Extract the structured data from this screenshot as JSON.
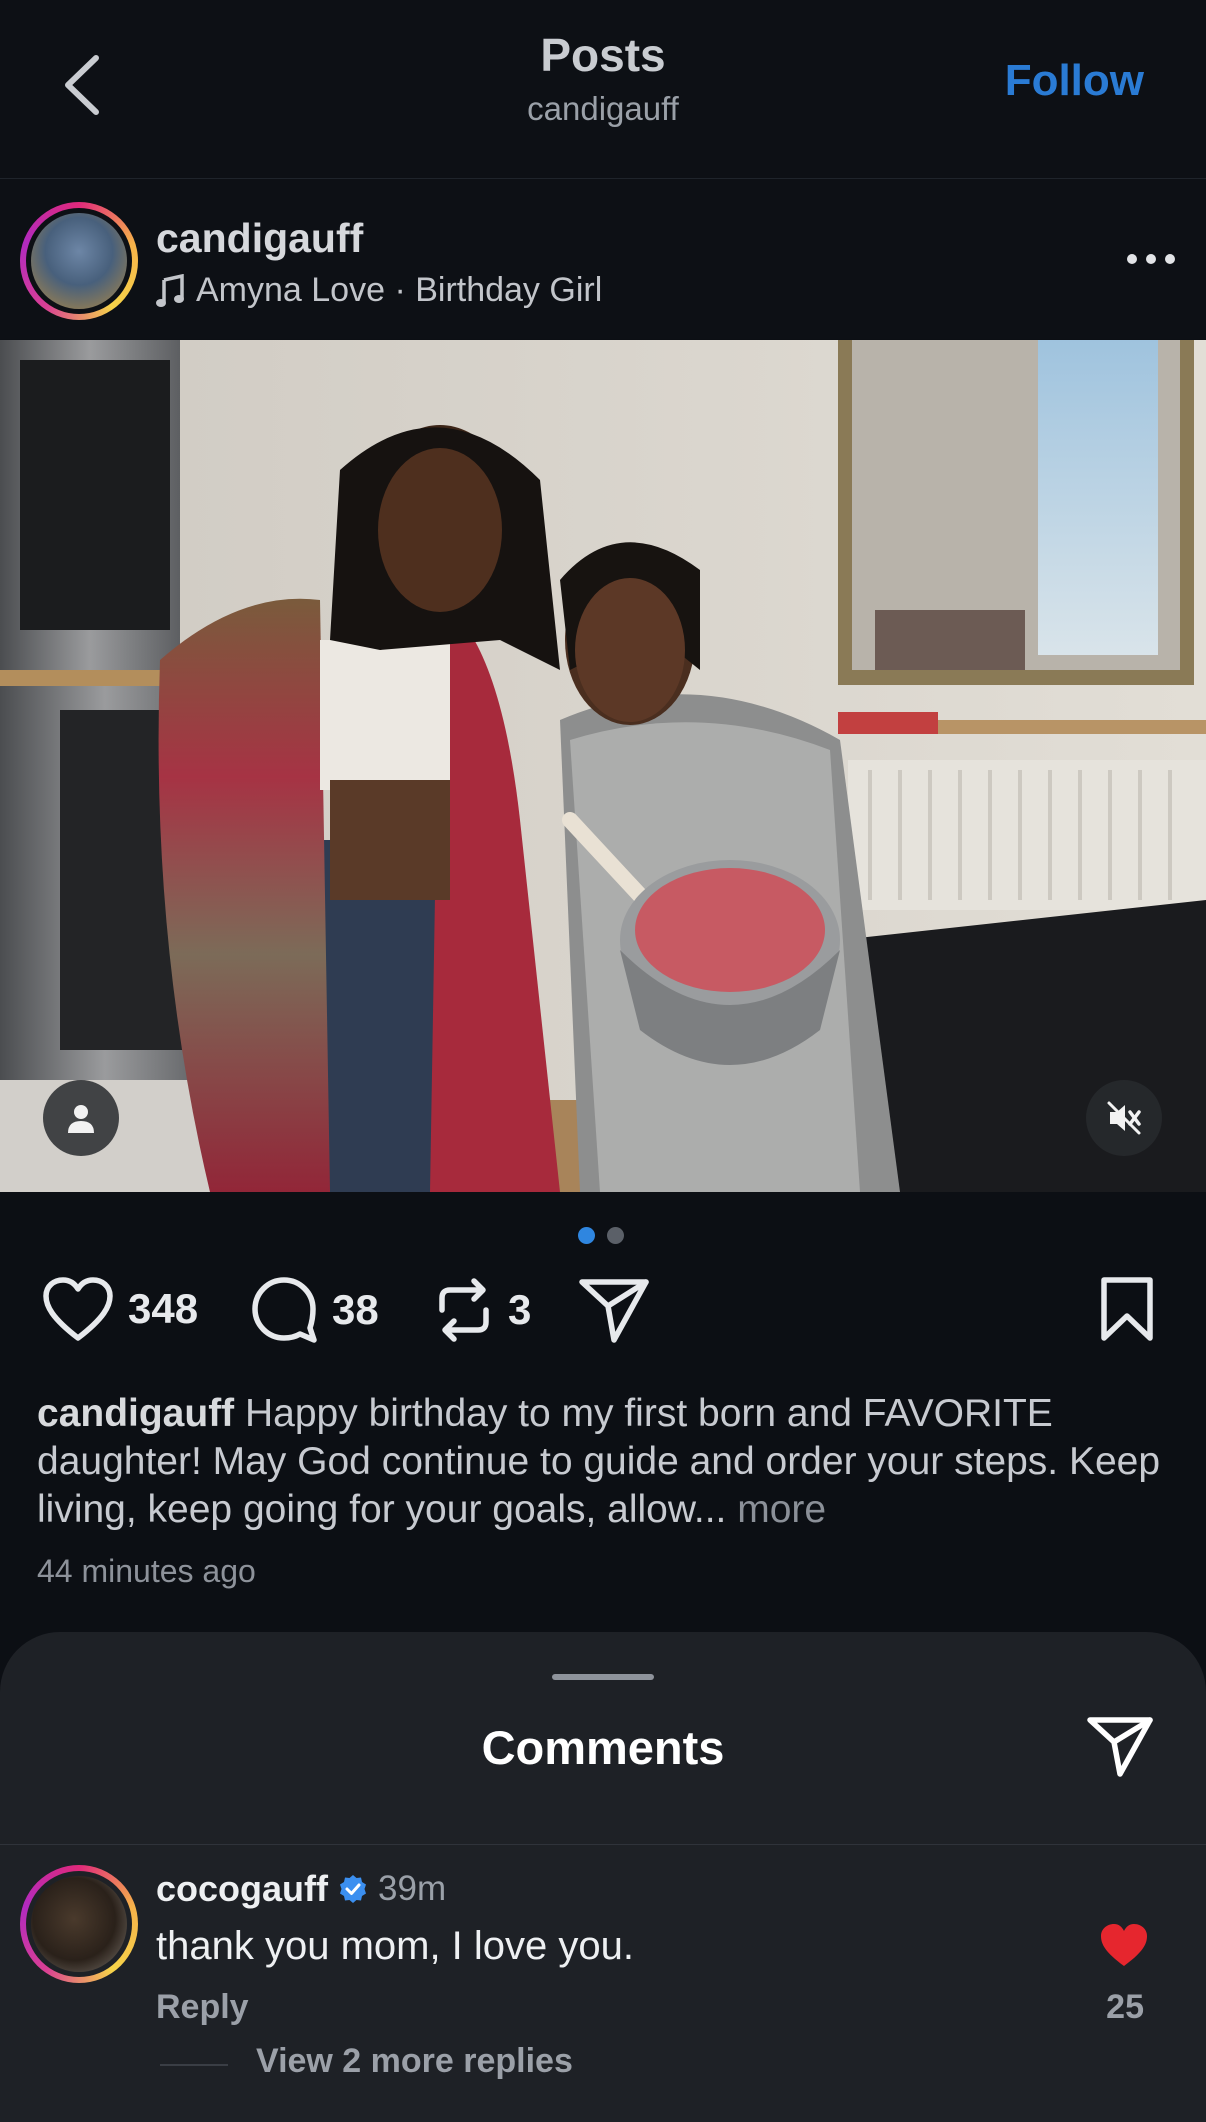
{
  "header": {
    "title": "Posts",
    "subtitle": "candigauff",
    "follow_label": "Follow"
  },
  "post": {
    "username": "candigauff",
    "song": "Amyna Love · Birthday Girl",
    "likes": "348",
    "comments": "38",
    "reposts": "3",
    "caption_user": "candigauff",
    "caption_text": "Happy birthday to my first born and FAVORITE daughter!  May God continue to guide and order your steps. Keep living, keep going for your goals, allow...",
    "caption_more": "more",
    "time": "44 minutes ago",
    "carousel": {
      "count": 2,
      "active_index": 0
    }
  },
  "comments_sheet": {
    "title": "Comments",
    "comment": {
      "username": "cocogauff",
      "verified": true,
      "time": "39m",
      "text": "thank you mom, I love you.",
      "reply_label": "Reply",
      "likes": "25",
      "liked": true,
      "view_replies": "View 2 more replies"
    }
  },
  "icons": [
    "chevron-left-icon",
    "music-note-icon",
    "more-horizontal-icon",
    "user-tag-icon",
    "mute-icon",
    "heart-icon",
    "comment-icon",
    "repost-icon",
    "send-icon",
    "bookmark-icon",
    "verified-badge-icon"
  ],
  "colors": {
    "background": "#0c0f14",
    "accent": "#2a7bd4",
    "sheet": "#1e2126",
    "heart_liked": "#e6262e",
    "verified": "#3b8ff0"
  }
}
